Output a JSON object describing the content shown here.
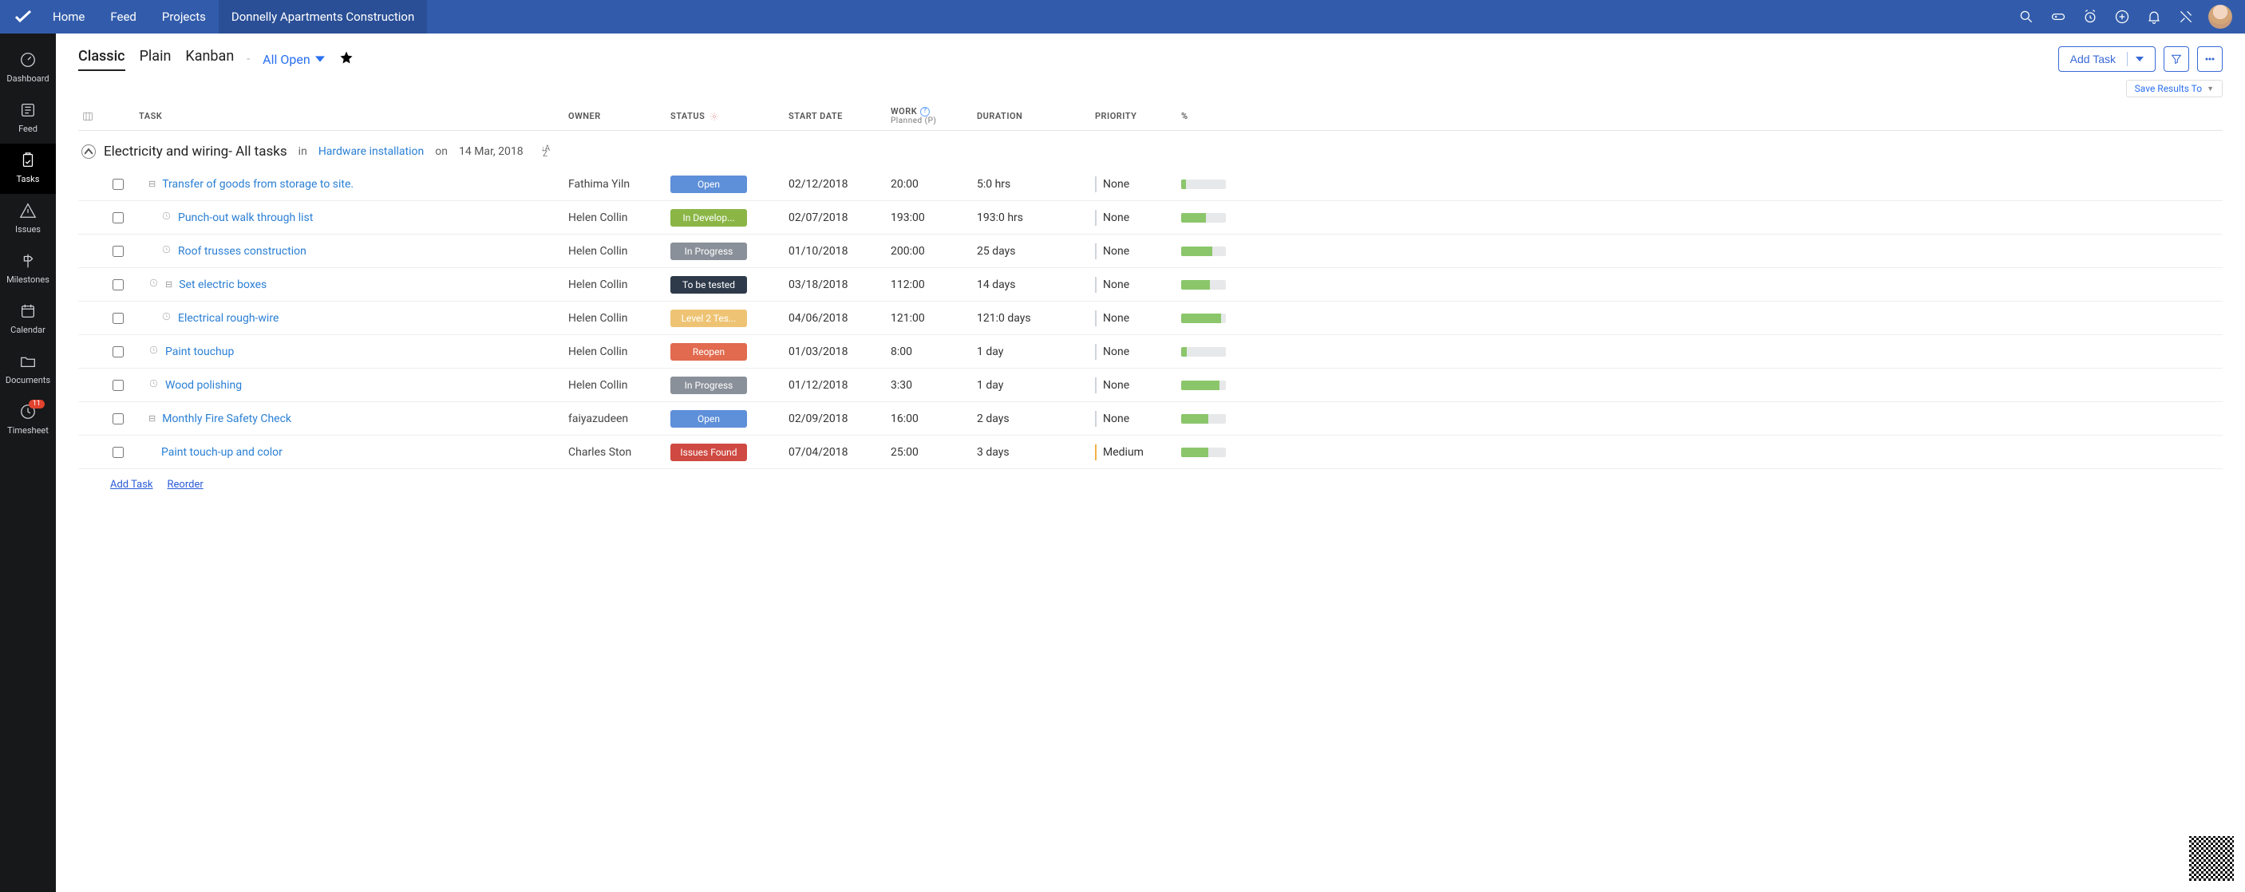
{
  "topnav": {
    "items": [
      {
        "label": "Home"
      },
      {
        "label": "Feed"
      },
      {
        "label": "Projects"
      },
      {
        "label": "Donnelly Apartments Construction",
        "active": true
      }
    ]
  },
  "leftrail": {
    "items": [
      {
        "label": "Dashboard",
        "icon": "gauge-icon"
      },
      {
        "label": "Feed",
        "icon": "feed-icon"
      },
      {
        "label": "Tasks",
        "icon": "clipboard-icon",
        "active": true
      },
      {
        "label": "Issues",
        "icon": "warning-icon"
      },
      {
        "label": "Milestones",
        "icon": "signpost-icon"
      },
      {
        "label": "Calendar",
        "icon": "calendar-icon"
      },
      {
        "label": "Documents",
        "icon": "folder-icon"
      },
      {
        "label": "Timesheet",
        "icon": "clock-icon",
        "badge": "11"
      }
    ]
  },
  "toolbar": {
    "views": [
      {
        "label": "Classic",
        "active": true
      },
      {
        "label": "Plain"
      },
      {
        "label": "Kanban"
      }
    ],
    "filter": "All Open",
    "add_task_label": "Add Task",
    "save_results_label": "Save Results To"
  },
  "columns": {
    "task": "TASK",
    "owner": "OWNER",
    "status": "STATUS",
    "start": "START DATE",
    "work_top": "WORK",
    "work_sub": "Planned (P)",
    "duration": "DURATION",
    "priority": "PRIORITY",
    "pct": "%"
  },
  "group": {
    "title": "Electricity and wiring- All tasks",
    "in_word": "in",
    "parent": "Hardware installation",
    "on_word": "on",
    "date": "14 Mar, 2018"
  },
  "status_colors": {
    "Open": "#5e8fd9",
    "In Develop...": "#8bb646",
    "In Progress": "#8a9099",
    "To be tested": "#2e3a4a",
    "Level 2 Tes...": "#eec474",
    "Reopen": "#e16a4f",
    "Issues Found": "#cf4a42"
  },
  "rows": [
    {
      "indent": 1,
      "tree": true,
      "clock": false,
      "task": "Transfer of goods from storage to site.",
      "owner": "Fathima Yiln",
      "status": "Open",
      "start": "02/12/2018",
      "work": "20:00",
      "duration": "5:0 hrs",
      "priority": "None",
      "pct": 10
    },
    {
      "indent": 2,
      "tree": false,
      "clock": true,
      "task": "Punch-out walk through list",
      "owner": "Helen Collin",
      "status": "In Develop...",
      "start": "02/07/2018",
      "work": "193:00",
      "duration": "193:0 hrs",
      "priority": "None",
      "pct": 55
    },
    {
      "indent": 2,
      "tree": false,
      "clock": true,
      "task": "Roof trusses construction",
      "owner": "Helen Collin",
      "status": "In Progress",
      "start": "01/10/2018",
      "work": "200:00",
      "duration": "25 days",
      "priority": "None",
      "pct": 70
    },
    {
      "indent": 1,
      "tree": true,
      "clock": true,
      "task": "Set electric boxes",
      "owner": "Helen Collin",
      "status": "To be tested",
      "start": "03/18/2018",
      "work": "112:00",
      "duration": "14 days",
      "priority": "None",
      "pct": 65
    },
    {
      "indent": 2,
      "tree": false,
      "clock": true,
      "task": "Electrical rough-wire",
      "owner": "Helen Collin",
      "status": "Level 2 Tes...",
      "start": "04/06/2018",
      "work": "121:00",
      "duration": "121:0 days",
      "priority": "None",
      "pct": 90
    },
    {
      "indent": 1,
      "tree": false,
      "clock": true,
      "task": "Paint touchup",
      "owner": "Helen Collin",
      "status": "Reopen",
      "start": "01/03/2018",
      "work": "8:00",
      "duration": "1 day",
      "priority": "None",
      "pct": 12
    },
    {
      "indent": 1,
      "tree": false,
      "clock": true,
      "task": "Wood polishing",
      "owner": "Helen Collin",
      "status": "In Progress",
      "start": "01/12/2018",
      "work": "3:30",
      "duration": "1 day",
      "priority": "None",
      "pct": 85
    },
    {
      "indent": 1,
      "tree": true,
      "clock": false,
      "task": "Monthly Fire Safety Check",
      "owner": "faiyazudeen",
      "status": "Open",
      "start": "02/09/2018",
      "work": "16:00",
      "duration": "2 days",
      "priority": "None",
      "pct": 60
    },
    {
      "indent": 2,
      "tree": false,
      "clock": false,
      "task": "Paint touch-up and color",
      "owner": "Charles Ston",
      "status": "Issues Found",
      "start": "07/04/2018",
      "work": "25:00",
      "duration": "3 days",
      "priority": "Medium",
      "pct": 60
    }
  ],
  "footer": {
    "add_task": "Add Task",
    "reorder": "Reorder"
  }
}
